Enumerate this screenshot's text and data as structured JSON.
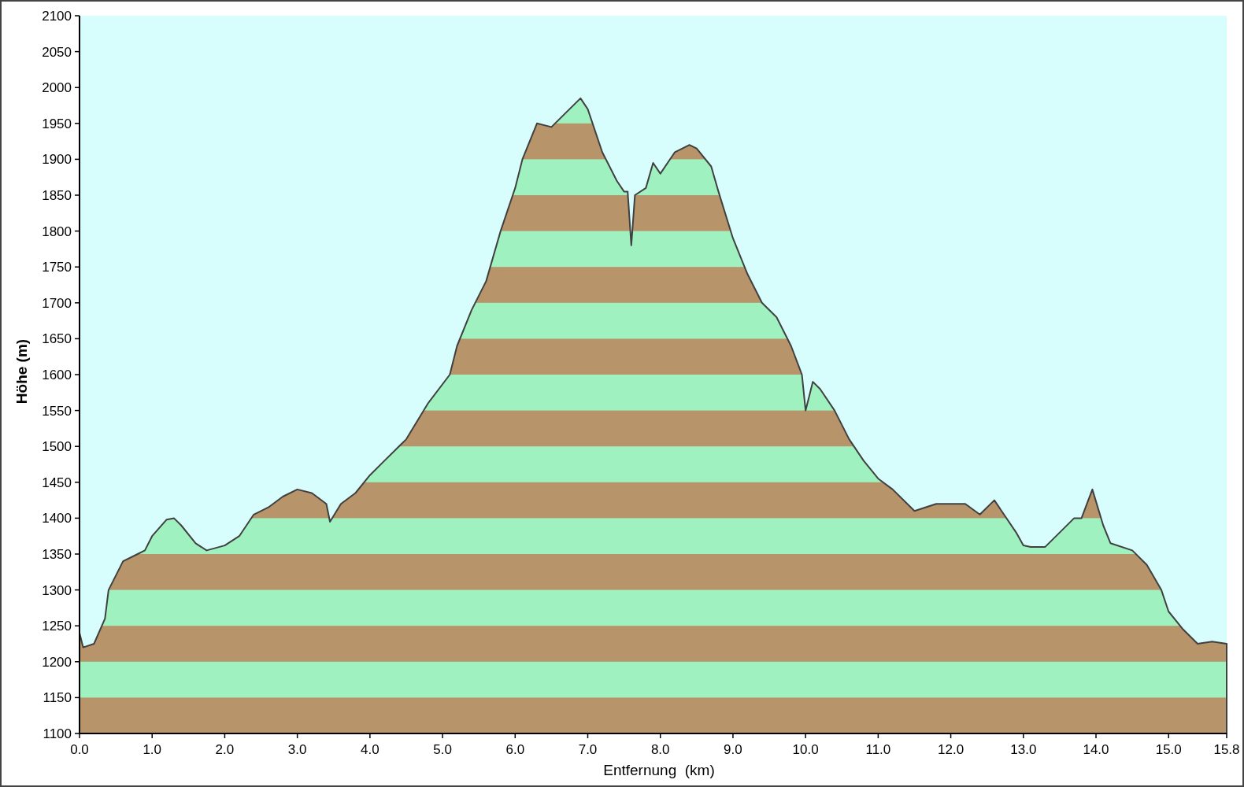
{
  "chart": {
    "chart_data": {
      "type": "area",
      "xlabel": "Entfernung  (km)",
      "ylabel": "Höhe (m)",
      "x": [
        0.0,
        0.05,
        0.2,
        0.35,
        0.4,
        0.6,
        0.8,
        0.9,
        1.0,
        1.2,
        1.3,
        1.4,
        1.6,
        1.75,
        2.0,
        2.2,
        2.4,
        2.6,
        2.8,
        3.0,
        3.2,
        3.4,
        3.45,
        3.6,
        3.8,
        4.0,
        4.2,
        4.5,
        4.8,
        5.1,
        5.2,
        5.4,
        5.6,
        5.8,
        6.0,
        6.1,
        6.3,
        6.5,
        6.7,
        6.9,
        7.0,
        7.2,
        7.4,
        7.5,
        7.55,
        7.6,
        7.65,
        7.8,
        7.9,
        8.0,
        8.2,
        8.4,
        8.5,
        8.7,
        8.8,
        9.0,
        9.2,
        9.4,
        9.6,
        9.8,
        9.95,
        10.0,
        10.1,
        10.2,
        10.4,
        10.6,
        10.8,
        11.0,
        11.2,
        11.5,
        11.8,
        12.0,
        12.2,
        12.4,
        12.6,
        12.7,
        12.9,
        13.0,
        13.1,
        13.3,
        13.5,
        13.7,
        13.8,
        13.95,
        14.1,
        14.2,
        14.5,
        14.7,
        14.9,
        15.0,
        15.2,
        15.4,
        15.6,
        15.8
      ],
      "series": [
        {
          "color": "#404040",
          "values": [
            1240,
            1220,
            1225,
            1260,
            1300,
            1340,
            1350,
            1355,
            1375,
            1398,
            1400,
            1390,
            1365,
            1355,
            1362,
            1375,
            1405,
            1415,
            1430,
            1440,
            1435,
            1420,
            1395,
            1420,
            1435,
            1460,
            1480,
            1510,
            1560,
            1600,
            1640,
            1690,
            1730,
            1800,
            1860,
            1900,
            1950,
            1945,
            1965,
            1985,
            1970,
            1910,
            1870,
            1855,
            1855,
            1780,
            1850,
            1860,
            1895,
            1880,
            1910,
            1920,
            1915,
            1890,
            1855,
            1790,
            1740,
            1700,
            1680,
            1640,
            1600,
            1550,
            1590,
            1580,
            1550,
            1510,
            1480,
            1455,
            1440,
            1410,
            1420,
            1420,
            1420,
            1405,
            1425,
            1410,
            1380,
            1362,
            1360,
            1360,
            1380,
            1400,
            1400,
            1440,
            1390,
            1365,
            1355,
            1335,
            1300,
            1270,
            1245,
            1225,
            1228,
            1225
          ]
        }
      ],
      "xlim": [
        0,
        15.8
      ],
      "ylim": [
        1100,
        2100
      ],
      "xticks": [
        {
          "value": 0,
          "label": "0.0"
        },
        {
          "value": 1,
          "label": "1.0"
        },
        {
          "value": 2,
          "label": "2.0"
        },
        {
          "value": 3,
          "label": "3.0"
        },
        {
          "value": 4,
          "label": "4.0"
        },
        {
          "value": 5,
          "label": "5.0"
        },
        {
          "value": 6,
          "label": "6.0"
        },
        {
          "value": 7,
          "label": "7.0"
        },
        {
          "value": 8,
          "label": "8.0"
        },
        {
          "value": 9,
          "label": "9.0"
        },
        {
          "value": 10,
          "label": "10.0"
        },
        {
          "value": 11,
          "label": "11.0"
        },
        {
          "value": 12,
          "label": "12.0"
        },
        {
          "value": 13,
          "label": "13.0"
        },
        {
          "value": 14,
          "label": "14.0"
        },
        {
          "value": 15,
          "label": "15.0"
        },
        {
          "value": 15.8,
          "label": "15.8"
        }
      ],
      "yticks": [
        1100,
        1150,
        1200,
        1250,
        1300,
        1350,
        1400,
        1450,
        1500,
        1550,
        1600,
        1650,
        1700,
        1750,
        1800,
        1850,
        1900,
        1950,
        2000,
        2050,
        2100
      ]
    }
  }
}
